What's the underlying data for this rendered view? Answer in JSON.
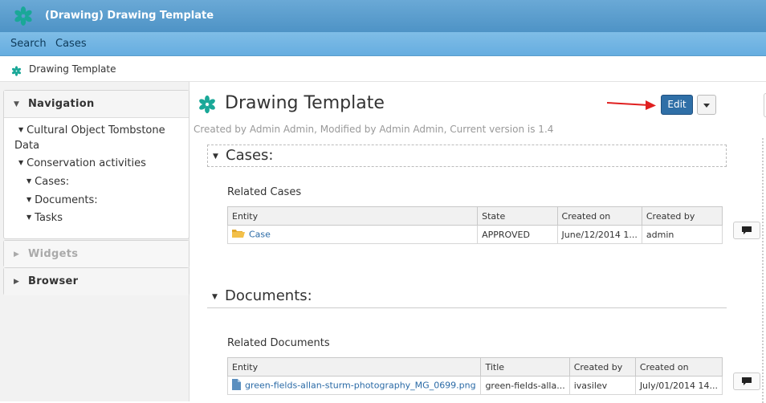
{
  "app": {
    "title": "(Drawing) Drawing Template"
  },
  "menu": {
    "items": [
      "Search",
      "Cases"
    ]
  },
  "breadcrumb": {
    "text": "Drawing Template"
  },
  "sidebar": {
    "navigation": {
      "label": "Navigation",
      "tree": [
        "Cultural Object Tombstone",
        "Data",
        "Conservation activities",
        "Cases:",
        "Documents:",
        "Tasks"
      ]
    },
    "widgets": {
      "label": "Widgets"
    },
    "browser": {
      "label": "Browser"
    }
  },
  "page": {
    "title": "Drawing Template",
    "meta": "Created by Admin Admin, Modified by Admin Admin, Current version is 1.4",
    "edit_label": "Edit"
  },
  "cases": {
    "heading": "Cases:",
    "related_label": "Related Cases",
    "columns": [
      "Entity",
      "State",
      "Created on",
      "Created by"
    ],
    "rows": [
      {
        "entity": "Case",
        "state": "APPROVED",
        "created_on": "June/12/2014 1...",
        "created_by": "admin"
      }
    ]
  },
  "documents": {
    "heading": "Documents:",
    "related_label": "Related Documents",
    "columns": [
      "Entity",
      "Title",
      "Created by",
      "Created on"
    ],
    "rows": [
      {
        "entity": "green-fields-allan-sturm-photography_MG_0699.png",
        "title": "green-fields-alla...",
        "created_by": "ivasilev",
        "created_on": "July/01/2014 14..."
      }
    ]
  },
  "colors": {
    "brand_teal": "#1aa898",
    "edit_blue": "#2f6fa7",
    "annotation_arrow": "#e02020"
  },
  "icons": {
    "logo": "asterisk-logo-icon",
    "folder": "folder-icon",
    "file": "file-icon",
    "comment": "comment-icon"
  }
}
